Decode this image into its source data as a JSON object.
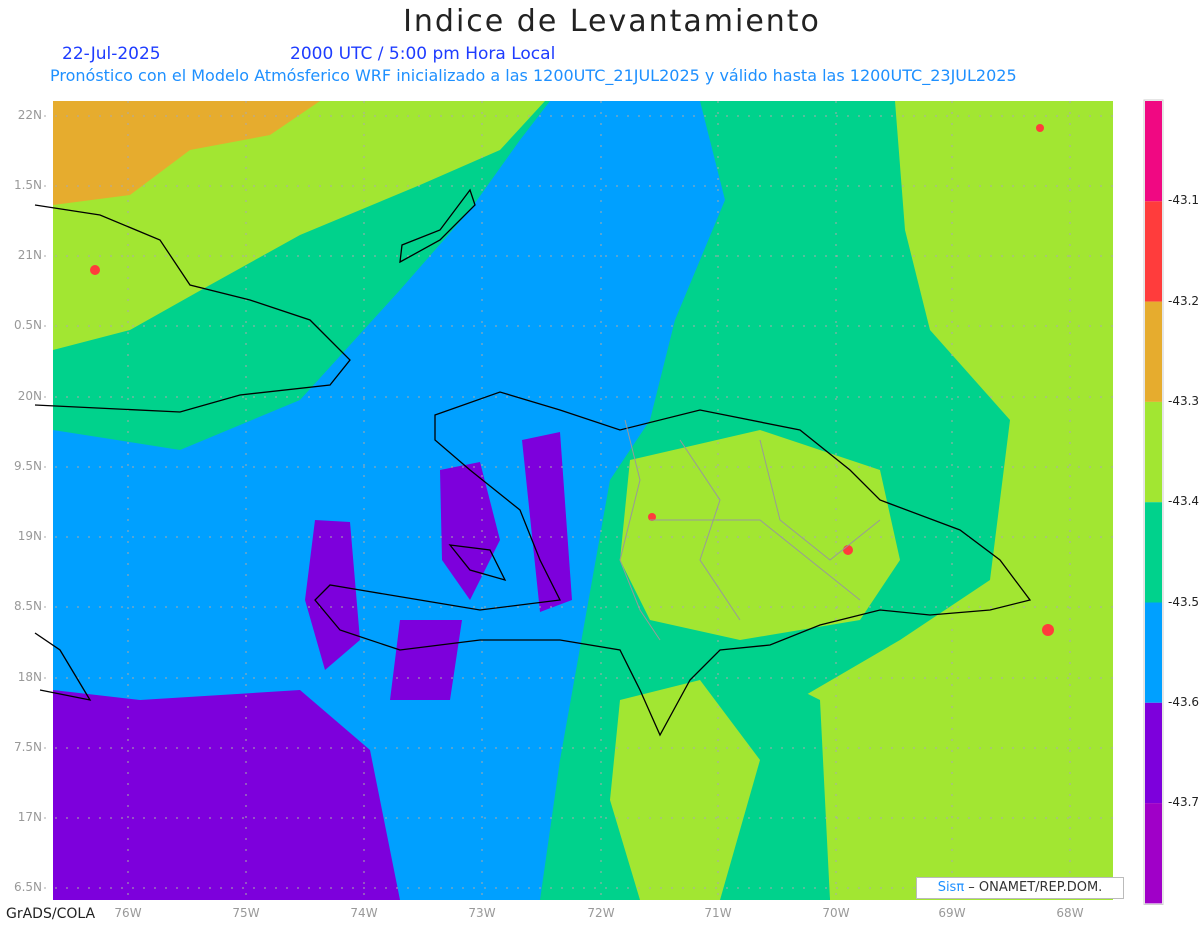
{
  "header": {
    "title": "Indice de Levantamiento",
    "date": "22-Jul-2025",
    "time": "2000 UTC / 5:00 pm Hora Local",
    "subtitle": "Pronóstico con el Modelo Atmósferico WRF inicializado a las 1200UTC_21JUL2025 y válido hasta las  1200UTC_23JUL2025"
  },
  "map": {
    "lat_labels": [
      "22N",
      "1.5N",
      "21N",
      "0.5N",
      "20N",
      "9.5N",
      "19N",
      "8.5N",
      "18N",
      "7.5N",
      "17N",
      "6.5N"
    ],
    "lon_labels": [
      "76W",
      "75W",
      "74W",
      "73W",
      "72W",
      "71W",
      "70W",
      "69W",
      "68W"
    ],
    "region": "Hispaniola / Greater Antilles",
    "grid": true
  },
  "colorbar": {
    "labels": [
      "-43.1",
      "-43.2",
      "-43.3",
      "-43.4",
      "-43.5",
      "-43.6",
      "-43.7"
    ],
    "colors": [
      "#f00882",
      "#ff3c3c",
      "#e6ac2e",
      "#a2e632",
      "#00d28c",
      "#00a0ff",
      "#7d00dc",
      "#a000c8"
    ]
  },
  "footer": {
    "software": "GrADS/COLA",
    "credit_brand": "Sisπ",
    "credit_text": " –  ONAMET/REP.DOM."
  }
}
